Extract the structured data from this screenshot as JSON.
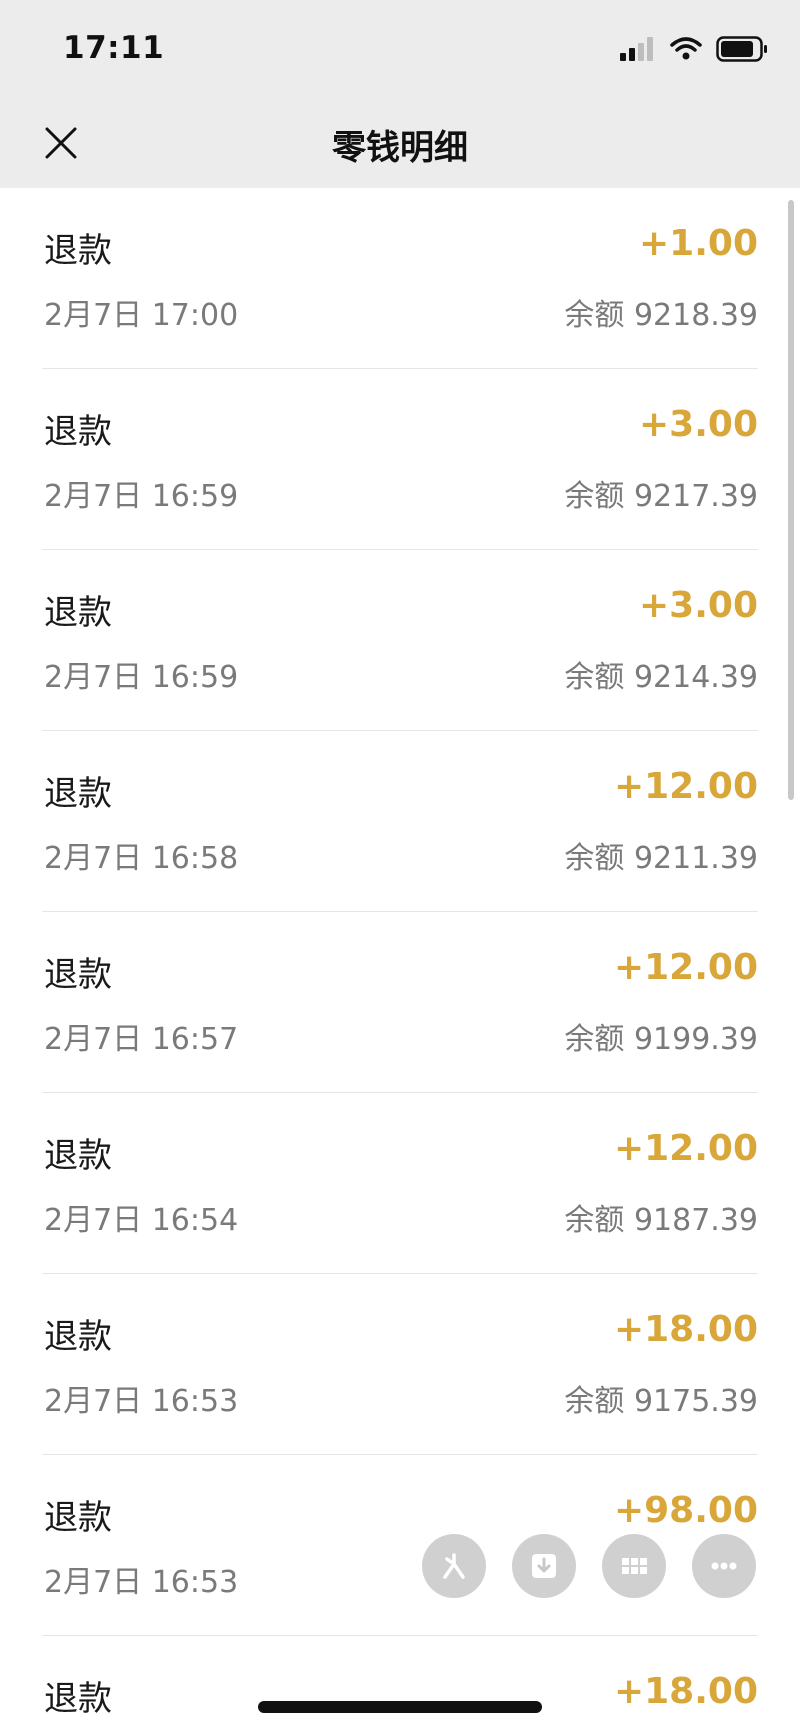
{
  "status_bar": {
    "time": "17:11"
  },
  "nav": {
    "title": "零钱明细"
  },
  "transactions": [
    {
      "title": "退款",
      "amount": "+1.00",
      "time": "2月7日 17:00",
      "balance": "余额 9218.39"
    },
    {
      "title": "退款",
      "amount": "+3.00",
      "time": "2月7日 16:59",
      "balance": "余额 9217.39"
    },
    {
      "title": "退款",
      "amount": "+3.00",
      "time": "2月7日 16:59",
      "balance": "余额 9214.39"
    },
    {
      "title": "退款",
      "amount": "+12.00",
      "time": "2月7日 16:58",
      "balance": "余额 9211.39"
    },
    {
      "title": "退款",
      "amount": "+12.00",
      "time": "2月7日 16:57",
      "balance": "余额 9199.39"
    },
    {
      "title": "退款",
      "amount": "+12.00",
      "time": "2月7日 16:54",
      "balance": "余额 9187.39"
    },
    {
      "title": "退款",
      "amount": "+18.00",
      "time": "2月7日 16:53",
      "balance": "余额 9175.39"
    },
    {
      "title": "退款",
      "amount": "+98.00",
      "time": "2月7日 16:53",
      "balance": ""
    },
    {
      "title": "退款",
      "amount": "+18.00",
      "time": "",
      "balance": ""
    }
  ],
  "colors": {
    "amount": "#d9a63a",
    "header_bg": "#ececec",
    "secondary_text": "#7a7a7a"
  },
  "icons": {
    "close": "close-icon",
    "signal": "signal-icon",
    "wifi": "wifi-icon",
    "battery": "battery-icon",
    "float_1": "sparkle-icon",
    "float_2": "download-icon",
    "float_3": "grid-icon",
    "float_4": "more-icon"
  }
}
